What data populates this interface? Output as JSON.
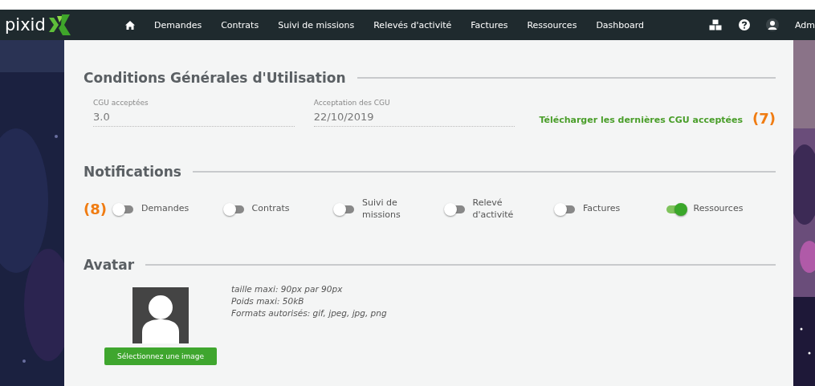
{
  "nav": {
    "logo": "pixid",
    "items": [
      "Demandes",
      "Contrats",
      "Suivi de missions",
      "Relevés d'activité",
      "Factures",
      "Ressources",
      "Dashboard"
    ],
    "user": "Adm"
  },
  "cgu": {
    "title": "Conditions Générales d'Utilisation",
    "fields": [
      {
        "label": "CGU acceptées",
        "value": "3.0"
      },
      {
        "label": "Acceptation des CGU",
        "value": "22/10/2019"
      }
    ],
    "link": "Télécharger les dernières CGU acceptées",
    "annotation": "(7)"
  },
  "notifications": {
    "title": "Notifications",
    "annotation": "(8)",
    "toggles": [
      {
        "label": "Demandes",
        "on": false
      },
      {
        "label": "Contrats",
        "on": false
      },
      {
        "label": "Suivi de missions",
        "on": false
      },
      {
        "label": "Relevé d'activité",
        "on": false
      },
      {
        "label": "Factures",
        "on": false
      },
      {
        "label": "Ressources",
        "on": true
      }
    ]
  },
  "avatar": {
    "title": "Avatar",
    "notes": [
      "taille maxi: 90px par 90px",
      "Poids maxi: 50kB",
      "Formats autorisés: gif, jpeg, jpg, png"
    ],
    "button": "Sélectionnez une image"
  }
}
